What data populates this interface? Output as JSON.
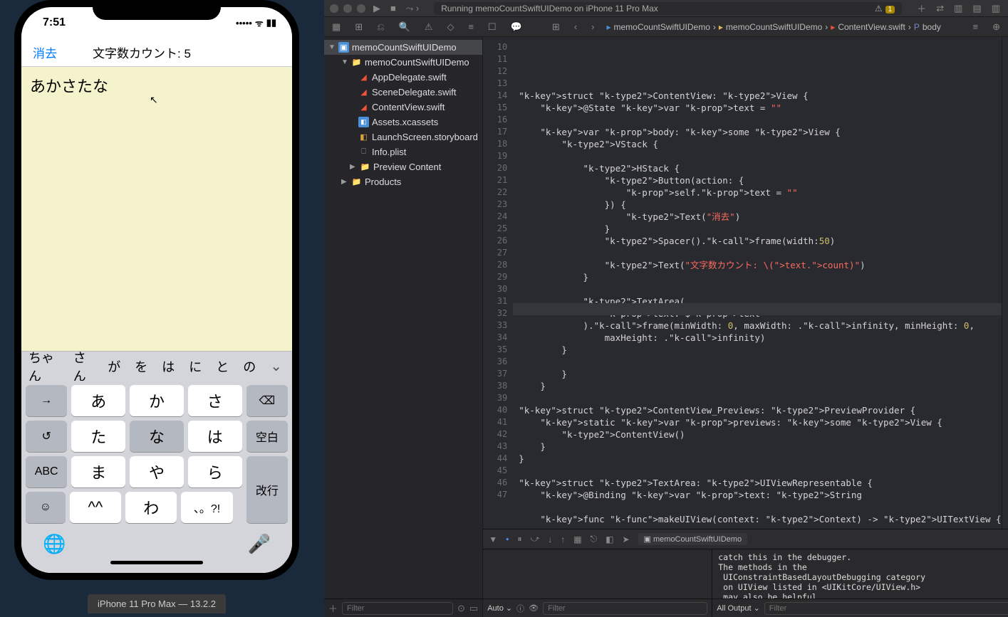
{
  "simulator": {
    "time": "7:51",
    "signal": "•••••",
    "wifi": "📶",
    "battery": "▮▮▯",
    "clear_button": "消去",
    "title": "文字数カウント: 5",
    "text_content": "あかさたな",
    "suggestions": [
      "ちゃん",
      "さん",
      "が",
      "を",
      "は",
      "に",
      "と",
      "の"
    ],
    "keys_r1": [
      "→",
      "あ",
      "か",
      "さ",
      "⌫"
    ],
    "keys_r2": [
      "↺",
      "た",
      "な",
      "は",
      "空白"
    ],
    "keys_r3": [
      "ABC",
      "ま",
      "や",
      "ら",
      "改行"
    ],
    "keys_r4": [
      "☺",
      "^^",
      "わ",
      "、。?!",
      ""
    ],
    "globe": "🌐",
    "mic": "🎤",
    "label": "iPhone 11 Pro Max — 13.2.2"
  },
  "xcode": {
    "run_status": "Running memoCountSwiftUIDemo on iPhone 11 Pro Max",
    "warn_count": "1",
    "breadcrumbs": [
      "memoCountSwiftUIDemo",
      "memoCountSwiftUIDemo",
      "ContentView.swift",
      "body"
    ],
    "tree": {
      "root": "memoCountSwiftUIDemo",
      "group": "memoCountSwiftUIDemo",
      "files": [
        "AppDelegate.swift",
        "SceneDelegate.swift",
        "ContentView.swift",
        "Assets.xcassets",
        "LaunchScreen.storyboard",
        "Info.plist"
      ],
      "preview": "Preview Content",
      "products": "Products"
    },
    "nav_filter_placeholder": "Filter",
    "code_start_line": 10,
    "code_lines": [
      "",
      "struct ContentView: View {",
      "    @State var text = \"\"",
      "",
      "    var body: some View {",
      "        VStack {",
      "",
      "            HStack {",
      "                Button(action: {",
      "                    self.text = \"\"",
      "                }) {",
      "                    Text(\"消去\")",
      "                }",
      "                Spacer().frame(width:50)",
      "",
      "                Text(\"文字数カウント: \\(text.count)\")",
      "            }",
      "",
      "            TextArea(",
      "                text: $text",
      "            ).frame(minWidth: 0, maxWidth: .infinity, minHeight: 0,",
      "                maxHeight: .infinity)",
      "        }",
      "",
      "        }",
      "    }",
      "",
      "struct ContentView_Previews: PreviewProvider {",
      "    static var previews: some View {",
      "        ContentView()",
      "    }",
      "}",
      "",
      "struct TextArea: UIViewRepresentable {",
      "    @Binding var text: String",
      "",
      "    func makeUIView(context: Context) -> UITextView {",
      ""
    ],
    "debug_target": "memoCountSwiftUIDemo",
    "console_text": "catch this in the debugger.\nThe methods in the\n UIConstraintBasedLayoutDebugging category\n on UIView listed in <UIKitCore/UIView.h>\n may also be helpful.",
    "auto_label": "Auto ⌄",
    "all_output_label": "All Output ⌄",
    "filter_placeholder": "Filter"
  }
}
